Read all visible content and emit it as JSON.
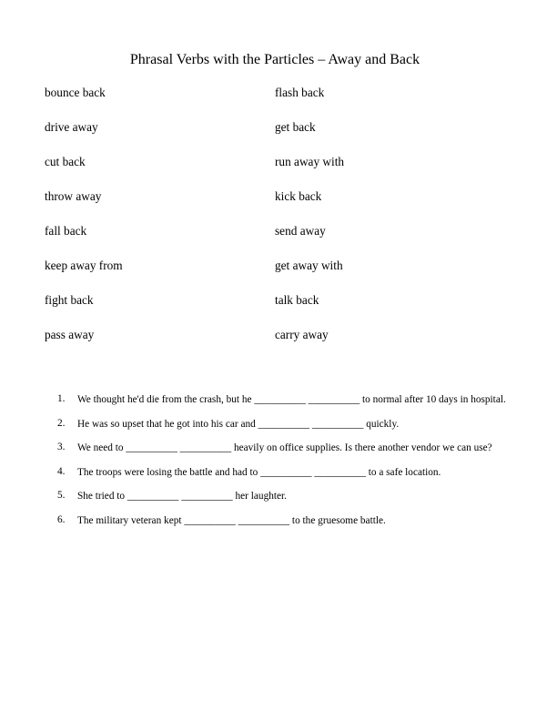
{
  "title": "Phrasal Verbs with the Particles – Away and Back",
  "vocab": {
    "left": [
      "bounce back",
      "drive away",
      "cut back",
      "throw away",
      "fall back",
      "keep away from",
      "fight back",
      "pass away"
    ],
    "right": [
      "flash back",
      "get back",
      "run away with",
      "kick back",
      "send away",
      "get away with",
      "talk back",
      "carry away"
    ]
  },
  "exercises": [
    {
      "num": "1.",
      "text": "We thought he'd die from the crash, but he __________ __________ to normal after 10 days in hospital."
    },
    {
      "num": "2.",
      "text": "He was so upset that he got into his car and __________ __________ quickly."
    },
    {
      "num": "3.",
      "text": "We need to __________ __________ heavily on office supplies. Is there another vendor we can use?"
    },
    {
      "num": "4.",
      "text": "The troops were losing the battle and had to __________  __________ to a safe location."
    },
    {
      "num": "5.",
      "text": "She tried to __________ __________ her laughter."
    },
    {
      "num": "6.",
      "text": "The military veteran kept __________ __________ to the gruesome battle."
    }
  ]
}
